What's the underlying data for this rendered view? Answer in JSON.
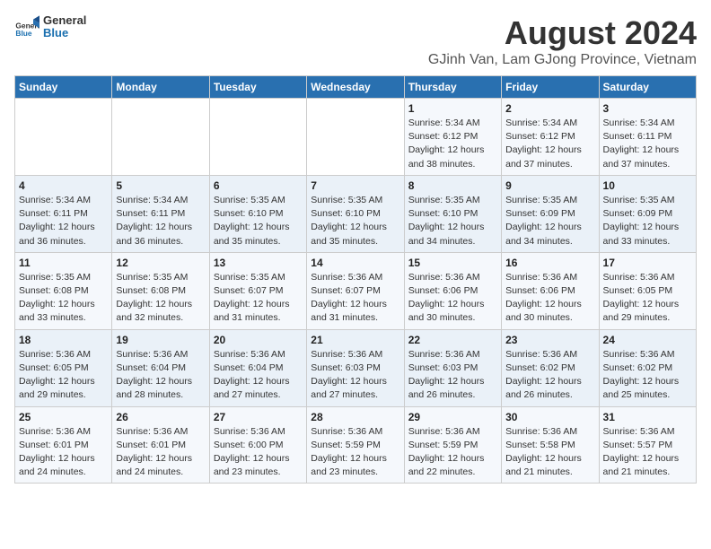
{
  "logo": {
    "text_general": "General",
    "text_blue": "Blue"
  },
  "title": "August 2024",
  "subtitle": "GJinh Van, Lam GJong Province, Vietnam",
  "days_of_week": [
    "Sunday",
    "Monday",
    "Tuesday",
    "Wednesday",
    "Thursday",
    "Friday",
    "Saturday"
  ],
  "weeks": [
    [
      {
        "day": "",
        "info": ""
      },
      {
        "day": "",
        "info": ""
      },
      {
        "day": "",
        "info": ""
      },
      {
        "day": "",
        "info": ""
      },
      {
        "day": "1",
        "info": "Sunrise: 5:34 AM\nSunset: 6:12 PM\nDaylight: 12 hours\nand 38 minutes."
      },
      {
        "day": "2",
        "info": "Sunrise: 5:34 AM\nSunset: 6:12 PM\nDaylight: 12 hours\nand 37 minutes."
      },
      {
        "day": "3",
        "info": "Sunrise: 5:34 AM\nSunset: 6:11 PM\nDaylight: 12 hours\nand 37 minutes."
      }
    ],
    [
      {
        "day": "4",
        "info": "Sunrise: 5:34 AM\nSunset: 6:11 PM\nDaylight: 12 hours\nand 36 minutes."
      },
      {
        "day": "5",
        "info": "Sunrise: 5:34 AM\nSunset: 6:11 PM\nDaylight: 12 hours\nand 36 minutes."
      },
      {
        "day": "6",
        "info": "Sunrise: 5:35 AM\nSunset: 6:10 PM\nDaylight: 12 hours\nand 35 minutes."
      },
      {
        "day": "7",
        "info": "Sunrise: 5:35 AM\nSunset: 6:10 PM\nDaylight: 12 hours\nand 35 minutes."
      },
      {
        "day": "8",
        "info": "Sunrise: 5:35 AM\nSunset: 6:10 PM\nDaylight: 12 hours\nand 34 minutes."
      },
      {
        "day": "9",
        "info": "Sunrise: 5:35 AM\nSunset: 6:09 PM\nDaylight: 12 hours\nand 34 minutes."
      },
      {
        "day": "10",
        "info": "Sunrise: 5:35 AM\nSunset: 6:09 PM\nDaylight: 12 hours\nand 33 minutes."
      }
    ],
    [
      {
        "day": "11",
        "info": "Sunrise: 5:35 AM\nSunset: 6:08 PM\nDaylight: 12 hours\nand 33 minutes."
      },
      {
        "day": "12",
        "info": "Sunrise: 5:35 AM\nSunset: 6:08 PM\nDaylight: 12 hours\nand 32 minutes."
      },
      {
        "day": "13",
        "info": "Sunrise: 5:35 AM\nSunset: 6:07 PM\nDaylight: 12 hours\nand 31 minutes."
      },
      {
        "day": "14",
        "info": "Sunrise: 5:36 AM\nSunset: 6:07 PM\nDaylight: 12 hours\nand 31 minutes."
      },
      {
        "day": "15",
        "info": "Sunrise: 5:36 AM\nSunset: 6:06 PM\nDaylight: 12 hours\nand 30 minutes."
      },
      {
        "day": "16",
        "info": "Sunrise: 5:36 AM\nSunset: 6:06 PM\nDaylight: 12 hours\nand 30 minutes."
      },
      {
        "day": "17",
        "info": "Sunrise: 5:36 AM\nSunset: 6:05 PM\nDaylight: 12 hours\nand 29 minutes."
      }
    ],
    [
      {
        "day": "18",
        "info": "Sunrise: 5:36 AM\nSunset: 6:05 PM\nDaylight: 12 hours\nand 29 minutes."
      },
      {
        "day": "19",
        "info": "Sunrise: 5:36 AM\nSunset: 6:04 PM\nDaylight: 12 hours\nand 28 minutes."
      },
      {
        "day": "20",
        "info": "Sunrise: 5:36 AM\nSunset: 6:04 PM\nDaylight: 12 hours\nand 27 minutes."
      },
      {
        "day": "21",
        "info": "Sunrise: 5:36 AM\nSunset: 6:03 PM\nDaylight: 12 hours\nand 27 minutes."
      },
      {
        "day": "22",
        "info": "Sunrise: 5:36 AM\nSunset: 6:03 PM\nDaylight: 12 hours\nand 26 minutes."
      },
      {
        "day": "23",
        "info": "Sunrise: 5:36 AM\nSunset: 6:02 PM\nDaylight: 12 hours\nand 26 minutes."
      },
      {
        "day": "24",
        "info": "Sunrise: 5:36 AM\nSunset: 6:02 PM\nDaylight: 12 hours\nand 25 minutes."
      }
    ],
    [
      {
        "day": "25",
        "info": "Sunrise: 5:36 AM\nSunset: 6:01 PM\nDaylight: 12 hours\nand 24 minutes."
      },
      {
        "day": "26",
        "info": "Sunrise: 5:36 AM\nSunset: 6:01 PM\nDaylight: 12 hours\nand 24 minutes."
      },
      {
        "day": "27",
        "info": "Sunrise: 5:36 AM\nSunset: 6:00 PM\nDaylight: 12 hours\nand 23 minutes."
      },
      {
        "day": "28",
        "info": "Sunrise: 5:36 AM\nSunset: 5:59 PM\nDaylight: 12 hours\nand 23 minutes."
      },
      {
        "day": "29",
        "info": "Sunrise: 5:36 AM\nSunset: 5:59 PM\nDaylight: 12 hours\nand 22 minutes."
      },
      {
        "day": "30",
        "info": "Sunrise: 5:36 AM\nSunset: 5:58 PM\nDaylight: 12 hours\nand 21 minutes."
      },
      {
        "day": "31",
        "info": "Sunrise: 5:36 AM\nSunset: 5:57 PM\nDaylight: 12 hours\nand 21 minutes."
      }
    ]
  ]
}
